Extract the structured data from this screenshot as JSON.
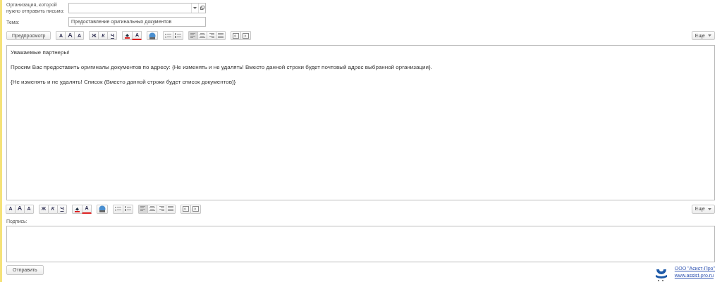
{
  "fields": [
    {
      "label": "Организация, которой нужно отправить письмо:",
      "kind": "combo"
    },
    {
      "label": "Тема:",
      "value": "Предоставление оригинальных документов",
      "kind": "text"
    }
  ],
  "toolbar_top": {
    "preview": "Предпросмотр",
    "more": "Еще",
    "groups": [
      [
        {
          "kind": "font",
          "label": "A"
        },
        {
          "kind": "font-up",
          "label": "A"
        },
        {
          "kind": "font-down",
          "label": "A"
        }
      ],
      [
        {
          "kind": "bold",
          "label": "Ж"
        },
        {
          "kind": "italic",
          "label": "К"
        },
        {
          "kind": "underline",
          "label": "Ч"
        }
      ],
      [
        {
          "kind": "fill-color"
        },
        {
          "kind": "text-color",
          "label": "A"
        }
      ],
      [
        {
          "kind": "image"
        }
      ],
      [
        {
          "kind": "bullet-list"
        },
        {
          "kind": "number-list"
        }
      ],
      [
        {
          "kind": "align-left",
          "selected": true
        },
        {
          "kind": "align-center",
          "selected": false
        },
        {
          "kind": "align-right",
          "selected": false
        },
        {
          "kind": "align-justify",
          "selected": false
        }
      ],
      [
        {
          "kind": "outdent"
        },
        {
          "kind": "indent"
        }
      ]
    ]
  },
  "body": [
    "Уважаемые партнеры!",
    "Просим Вас предоставить оригиналы документов по адресу: {Не изменять и не удалять! Вместо данной строки будет почтовый адрес выбранной организации}.",
    "{Не изменять и не удалять! Список (Вместо данной строки будет список документов)}"
  ],
  "toolbar_bottom": {
    "more": "Еще",
    "groups": [
      [
        {
          "kind": "font",
          "label": "A"
        },
        {
          "kind": "font-up",
          "label": "A"
        },
        {
          "kind": "font-down",
          "label": "A"
        }
      ],
      [
        {
          "kind": "bold",
          "label": "Ж"
        },
        {
          "kind": "italic",
          "label": "К"
        },
        {
          "kind": "underline",
          "label": "Ч"
        }
      ],
      [
        {
          "kind": "fill-color"
        },
        {
          "kind": "text-color",
          "label": "A"
        }
      ],
      [
        {
          "kind": "image"
        }
      ],
      [
        {
          "kind": "bullet-list"
        },
        {
          "kind": "number-list"
        }
      ],
      [
        {
          "kind": "align-left",
          "selected": true
        },
        {
          "kind": "align-center",
          "selected": false
        },
        {
          "kind": "align-right",
          "selected": false
        },
        {
          "kind": "align-justify",
          "selected": false
        }
      ],
      [
        {
          "kind": "outdent"
        },
        {
          "kind": "indent"
        }
      ]
    ]
  },
  "signature": {
    "label": "Подпись:"
  },
  "send_button": "Отправить",
  "footer_links": [
    "ООО \"Асист-Про\"",
    "www.assist-pro.ru"
  ]
}
